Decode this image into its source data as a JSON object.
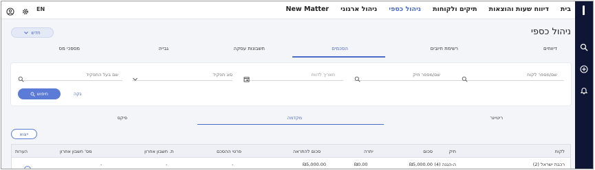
{
  "topbar": {
    "lang": "EN",
    "nav": [
      {
        "label": "בית",
        "active": false
      },
      {
        "label": "דיווח שעות והוצאות",
        "active": false
      },
      {
        "label": "תיקים ולקוחות",
        "active": false
      },
      {
        "label": "ניהול כספי",
        "active": true
      },
      {
        "label": "ניהול ארגוני",
        "active": false
      },
      {
        "label": "New Matter",
        "active": false
      }
    ]
  },
  "page": {
    "title": "ניהול כספי",
    "new_button": "חדש"
  },
  "tabs": [
    "דיווחים",
    "רשימת חיובים",
    "הסכמים",
    "חשבונות עסקה",
    "גבייה",
    "מספכי מס"
  ],
  "active_tab": 2,
  "filters": {
    "client": "שם/מספר לקוח",
    "matter": "שם/מספר תיק",
    "date": "תאריך לדווח",
    "role": "סוג תפקיד",
    "owner": "שם בעל התפקיד",
    "search_button": "חיפוש",
    "clear_link": "נקה"
  },
  "subtabs": [
    "ריטיינר",
    "מקדמה",
    "פיקס"
  ],
  "active_subtab": 1,
  "export_button": "ייצוא",
  "table": {
    "headers": [
      "לקוח",
      "תיק",
      "סכום",
      "יתרה",
      "סכום להתראה",
      "פרטי ההסכם",
      "ת. חשבון אחרון",
      "מס' חשבון אחרון",
      "הערות"
    ],
    "rows": [
      [
        "רכבת ישראל (2)",
        "ה-הגנה (4)",
        "₪5,000.00",
        "₪0.00",
        "₪5,000.00",
        "-",
        "-",
        "-",
        ""
      ]
    ]
  },
  "colors": {
    "accent": "#4a6cc8",
    "rail": "#0f1535",
    "button": "#5b7bd6"
  }
}
